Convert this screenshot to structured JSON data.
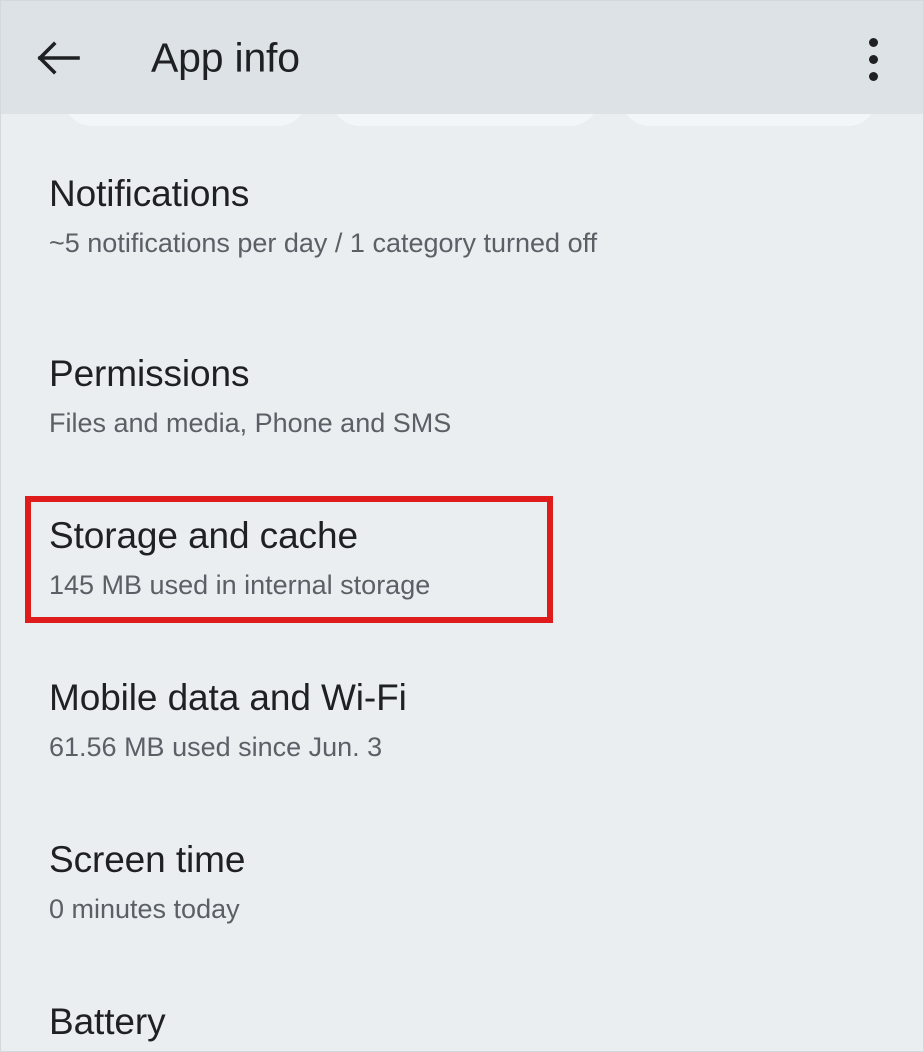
{
  "appbar": {
    "title": "App info",
    "back_icon": "arrow-back-icon",
    "overflow_icon": "more-vert-icon"
  },
  "colors": {
    "appbar_background": "#dde2e6",
    "content_background": "#eaeef1",
    "title_text": "#1f2023",
    "subtitle_text": "#5a6066",
    "annotation_red": "#e01b1b"
  },
  "list": {
    "items": [
      {
        "title": "Notifications",
        "subtitle": "~5 notifications per day / 1 category turned off"
      },
      {
        "title": "Permissions",
        "subtitle": "Files and media, Phone and SMS"
      },
      {
        "title": "Storage and cache",
        "subtitle": "145 MB used in internal storage"
      },
      {
        "title": "Mobile data and Wi-Fi",
        "subtitle": "61.56 MB used since Jun. 3"
      },
      {
        "title": "Screen time",
        "subtitle": "0 minutes today"
      },
      {
        "title": "Battery",
        "subtitle": ""
      }
    ]
  },
  "annotation": {
    "target": "Storage and cache"
  }
}
